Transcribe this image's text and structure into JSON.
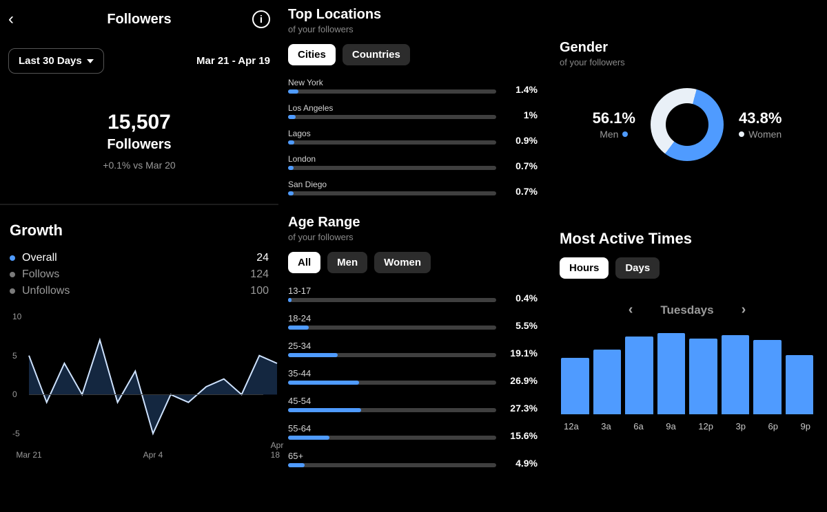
{
  "colors": {
    "accent": "#4f9bff",
    "women": "#e9f0f7"
  },
  "left": {
    "title": "Followers",
    "range_button": "Last 30 Days",
    "range_text": "Mar 21 - Apr 19",
    "count": "15,507",
    "count_label": "Followers",
    "delta": "+0.1% vs Mar 20",
    "growth_title": "Growth",
    "legend": [
      {
        "label": "Overall",
        "value": "24",
        "blue": true
      },
      {
        "label": "Follows",
        "value": "124",
        "blue": false
      },
      {
        "label": "Unfollows",
        "value": "100",
        "blue": false
      }
    ]
  },
  "chart_data": [
    {
      "type": "line",
      "title": "Growth",
      "ylabel": "",
      "ylim": [
        -5,
        10
      ],
      "yticks": [
        10,
        5,
        0,
        -5
      ],
      "x": [
        "Mar 21",
        "Mar 23",
        "Mar 25",
        "Mar 27",
        "Mar 29",
        "Mar 31",
        "Apr 2",
        "Apr 4",
        "Apr 6",
        "Apr 8",
        "Apr 10",
        "Apr 12",
        "Apr 14",
        "Apr 16",
        "Apr 18"
      ],
      "xticks": [
        "Mar 21",
        "Apr 4",
        "Apr 18"
      ],
      "series": [
        {
          "name": "Overall",
          "values": [
            5,
            -1,
            4,
            0,
            7,
            -1,
            3,
            -5,
            0,
            -1,
            1,
            2,
            0,
            5,
            4
          ]
        }
      ]
    },
    {
      "type": "bar",
      "title": "Top Locations — Cities",
      "categories": [
        "New York",
        "Los Angeles",
        "Lagos",
        "London",
        "San Diego"
      ],
      "values": [
        1.4,
        1.0,
        0.9,
        0.7,
        0.7
      ],
      "unit": "%"
    },
    {
      "type": "bar",
      "title": "Age Range — All",
      "categories": [
        "13-17",
        "18-24",
        "25-34",
        "35-44",
        "45-54",
        "55-64",
        "65+"
      ],
      "values": [
        0.4,
        5.5,
        19.1,
        26.9,
        27.3,
        15.6,
        4.9
      ],
      "unit": "%"
    },
    {
      "type": "pie",
      "title": "Gender",
      "categories": [
        "Men",
        "Women"
      ],
      "values": [
        56.1,
        43.8
      ],
      "unit": "%"
    },
    {
      "type": "bar",
      "title": "Most Active Times — Tuesdays (relative)",
      "categories": [
        "12a",
        "3a",
        "6a",
        "9a",
        "12p",
        "3p",
        "6p",
        "9p"
      ],
      "values": [
        68,
        78,
        94,
        98,
        92,
        96,
        90,
        72
      ],
      "ylim": [
        0,
        100
      ]
    }
  ],
  "locations": {
    "title": "Top Locations",
    "subtitle": "of your followers",
    "tabs": [
      "Cities",
      "Countries"
    ],
    "active_tab": "Cities",
    "rows": [
      {
        "label": "New York",
        "pct": "1.4%",
        "fill": 5
      },
      {
        "label": "Los Angeles",
        "pct": "1%",
        "fill": 3.5
      },
      {
        "label": "Lagos",
        "pct": "0.9%",
        "fill": 3
      },
      {
        "label": "London",
        "pct": "0.7%",
        "fill": 2.5
      },
      {
        "label": "San Diego",
        "pct": "0.7%",
        "fill": 2.5
      }
    ]
  },
  "age": {
    "title": "Age Range",
    "subtitle": "of your followers",
    "tabs": [
      "All",
      "Men",
      "Women"
    ],
    "active_tab": "All",
    "rows": [
      {
        "label": "13-17",
        "pct": "0.4%",
        "fill": 1.5
      },
      {
        "label": "18-24",
        "pct": "5.5%",
        "fill": 10
      },
      {
        "label": "25-34",
        "pct": "19.1%",
        "fill": 24
      },
      {
        "label": "35-44",
        "pct": "26.9%",
        "fill": 34
      },
      {
        "label": "45-54",
        "pct": "27.3%",
        "fill": 35
      },
      {
        "label": "55-64",
        "pct": "15.6%",
        "fill": 20
      },
      {
        "label": "65+",
        "pct": "4.9%",
        "fill": 8
      }
    ]
  },
  "gender": {
    "title": "Gender",
    "subtitle": "of your followers",
    "men_pct": "56.1%",
    "men_label": "Men",
    "women_pct": "43.8%",
    "women_label": "Women",
    "men_value": 56.1,
    "women_value": 43.8
  },
  "active_times": {
    "title": "Most Active Times",
    "tabs": [
      "Hours",
      "Days"
    ],
    "active_tab": "Hours",
    "day": "Tuesdays",
    "hours": [
      "12a",
      "3a",
      "6a",
      "9a",
      "12p",
      "3p",
      "6p",
      "9p"
    ],
    "heights": [
      68,
      78,
      94,
      98,
      92,
      96,
      90,
      72
    ]
  }
}
